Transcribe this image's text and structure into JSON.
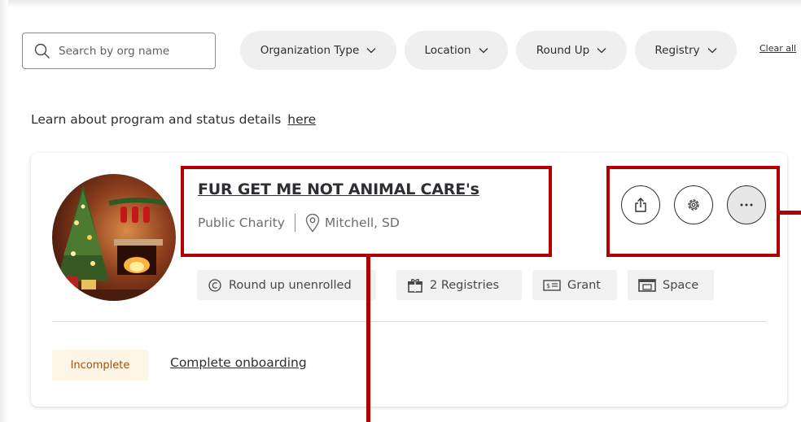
{
  "search": {
    "placeholder": "Search by org name",
    "icon": "search-icon"
  },
  "filters": [
    {
      "label": "Organization Type"
    },
    {
      "label": "Location"
    },
    {
      "label": "Round Up"
    },
    {
      "label": "Registry"
    }
  ],
  "clear_all": "Clear all",
  "learn_text": "Learn about program and status details",
  "learn_link": "here",
  "org": {
    "name": "FUR GET ME NOT ANIMAL CARE's",
    "type": "Public Charity",
    "location": "Mitchell, SD",
    "actions": {
      "share": "share-icon",
      "settings": "gear-icon",
      "more": "more-icon"
    },
    "chips": [
      {
        "label": "Round up unenrolled",
        "icon": "roundup-icon"
      },
      {
        "label": "2 Registries",
        "icon": "gift-icon"
      },
      {
        "label": "Grant",
        "icon": "grant-icon"
      },
      {
        "label": "Space",
        "icon": "space-icon"
      }
    ],
    "status": "Incomplete",
    "onboarding_link": "Complete onboarding"
  },
  "annotation_color": "#b00000"
}
